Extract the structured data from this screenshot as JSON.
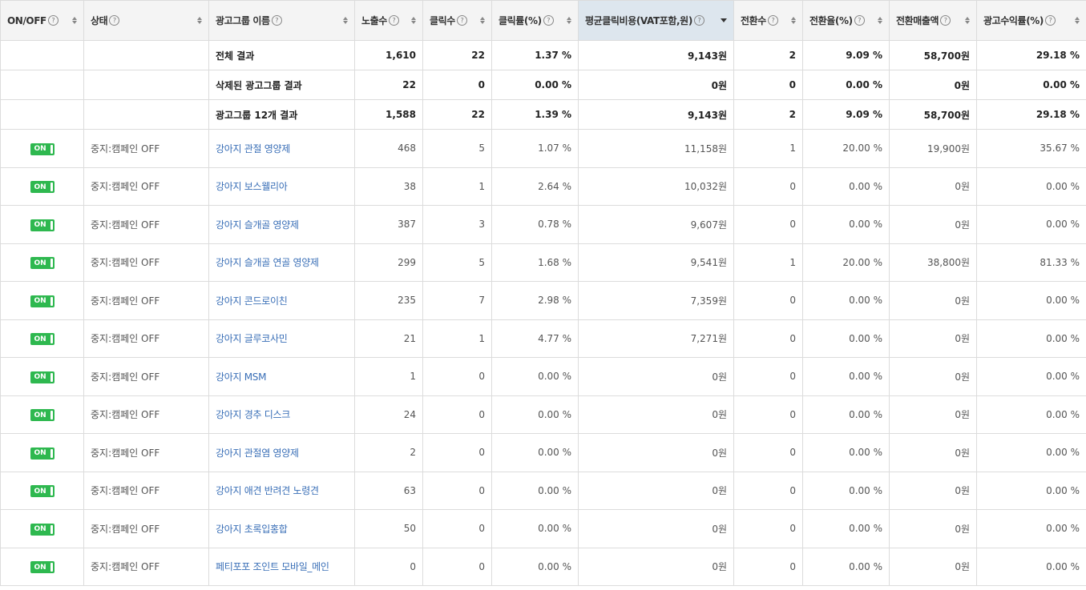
{
  "columns": [
    {
      "label": "ON/OFF",
      "help": "?"
    },
    {
      "label": "상태",
      "help": "?"
    },
    {
      "label": "광고그룹 이름",
      "help": "?"
    },
    {
      "label": "노출수",
      "help": "?"
    },
    {
      "label": "클릭수",
      "help": "?"
    },
    {
      "label": "클릭률(%)",
      "help": "?"
    },
    {
      "label": "평균클릭비용(VAT포함,원)",
      "help": "?"
    },
    {
      "label": "전환수",
      "help": "?"
    },
    {
      "label": "전환율(%)",
      "help": "?"
    },
    {
      "label": "전환매출액",
      "help": "?"
    },
    {
      "label": "광고수익률(%)",
      "help": "?"
    }
  ],
  "summary_rows": [
    {
      "name": "전체 결과",
      "impressions": "1,610",
      "clicks": "22",
      "ctr": "1.37 %",
      "cpc": "9,143원",
      "conversions": "2",
      "cvr": "9.09 %",
      "revenue": "58,700원",
      "roas": "29.18 %"
    },
    {
      "name": "삭제된 광고그룹 결과",
      "impressions": "22",
      "clicks": "0",
      "ctr": "0.00 %",
      "cpc": "0원",
      "conversions": "0",
      "cvr": "0.00 %",
      "revenue": "0원",
      "roas": "0.00 %"
    },
    {
      "name": "광고그룹 12개 결과",
      "impressions": "1,588",
      "clicks": "22",
      "ctr": "1.39 %",
      "cpc": "9,143원",
      "conversions": "2",
      "cvr": "9.09 %",
      "revenue": "58,700원",
      "roas": "29.18 %"
    }
  ],
  "rows": [
    {
      "toggle": "ON",
      "status": "중지:캠페인 OFF",
      "name": "강아지 관절 영양제",
      "impressions": "468",
      "clicks": "5",
      "ctr": "1.07 %",
      "cpc": "11,158원",
      "conversions": "1",
      "cvr": "20.00 %",
      "revenue": "19,900원",
      "roas": "35.67 %"
    },
    {
      "toggle": "ON",
      "status": "중지:캠페인 OFF",
      "name": "강아지 보스웰리아",
      "impressions": "38",
      "clicks": "1",
      "ctr": "2.64 %",
      "cpc": "10,032원",
      "conversions": "0",
      "cvr": "0.00 %",
      "revenue": "0원",
      "roas": "0.00 %"
    },
    {
      "toggle": "ON",
      "status": "중지:캠페인 OFF",
      "name": "강아지 슬개골 영양제",
      "impressions": "387",
      "clicks": "3",
      "ctr": "0.78 %",
      "cpc": "9,607원",
      "conversions": "0",
      "cvr": "0.00 %",
      "revenue": "0원",
      "roas": "0.00 %"
    },
    {
      "toggle": "ON",
      "status": "중지:캠페인 OFF",
      "name": "강아지 슬개골 연골 영양제",
      "impressions": "299",
      "clicks": "5",
      "ctr": "1.68 %",
      "cpc": "9,541원",
      "conversions": "1",
      "cvr": "20.00 %",
      "revenue": "38,800원",
      "roas": "81.33 %"
    },
    {
      "toggle": "ON",
      "status": "중지:캠페인 OFF",
      "name": "강아지 콘드로이친",
      "impressions": "235",
      "clicks": "7",
      "ctr": "2.98 %",
      "cpc": "7,359원",
      "conversions": "0",
      "cvr": "0.00 %",
      "revenue": "0원",
      "roas": "0.00 %"
    },
    {
      "toggle": "ON",
      "status": "중지:캠페인 OFF",
      "name": "강아지 글루코사민",
      "impressions": "21",
      "clicks": "1",
      "ctr": "4.77 %",
      "cpc": "7,271원",
      "conversions": "0",
      "cvr": "0.00 %",
      "revenue": "0원",
      "roas": "0.00 %"
    },
    {
      "toggle": "ON",
      "status": "중지:캠페인 OFF",
      "name": "강아지 MSM",
      "impressions": "1",
      "clicks": "0",
      "ctr": "0.00 %",
      "cpc": "0원",
      "conversions": "0",
      "cvr": "0.00 %",
      "revenue": "0원",
      "roas": "0.00 %"
    },
    {
      "toggle": "ON",
      "status": "중지:캠페인 OFF",
      "name": "강아지 경추 디스크",
      "impressions": "24",
      "clicks": "0",
      "ctr": "0.00 %",
      "cpc": "0원",
      "conversions": "0",
      "cvr": "0.00 %",
      "revenue": "0원",
      "roas": "0.00 %"
    },
    {
      "toggle": "ON",
      "status": "중지:캠페인 OFF",
      "name": "강아지 관절염 영양제",
      "impressions": "2",
      "clicks": "0",
      "ctr": "0.00 %",
      "cpc": "0원",
      "conversions": "0",
      "cvr": "0.00 %",
      "revenue": "0원",
      "roas": "0.00 %"
    },
    {
      "toggle": "ON",
      "status": "중지:캠페인 OFF",
      "name": "강아지 애견 반려견 노령견",
      "impressions": "63",
      "clicks": "0",
      "ctr": "0.00 %",
      "cpc": "0원",
      "conversions": "0",
      "cvr": "0.00 %",
      "revenue": "0원",
      "roas": "0.00 %"
    },
    {
      "toggle": "ON",
      "status": "중지:캠페인 OFF",
      "name": "강아지 초록입홍합",
      "impressions": "50",
      "clicks": "0",
      "ctr": "0.00 %",
      "cpc": "0원",
      "conversions": "0",
      "cvr": "0.00 %",
      "revenue": "0원",
      "roas": "0.00 %"
    },
    {
      "toggle": "ON",
      "status": "중지:캠페인 OFF",
      "name": "페티포포 조인트 모바일_메인",
      "impressions": "0",
      "clicks": "0",
      "ctr": "0.00 %",
      "cpc": "0원",
      "conversions": "0",
      "cvr": "0.00 %",
      "revenue": "0원",
      "roas": "0.00 %"
    }
  ],
  "colors": {
    "toggle_on": "#2eb84f",
    "link": "#3a6fb7",
    "sorted_header": "#dde6ee"
  }
}
